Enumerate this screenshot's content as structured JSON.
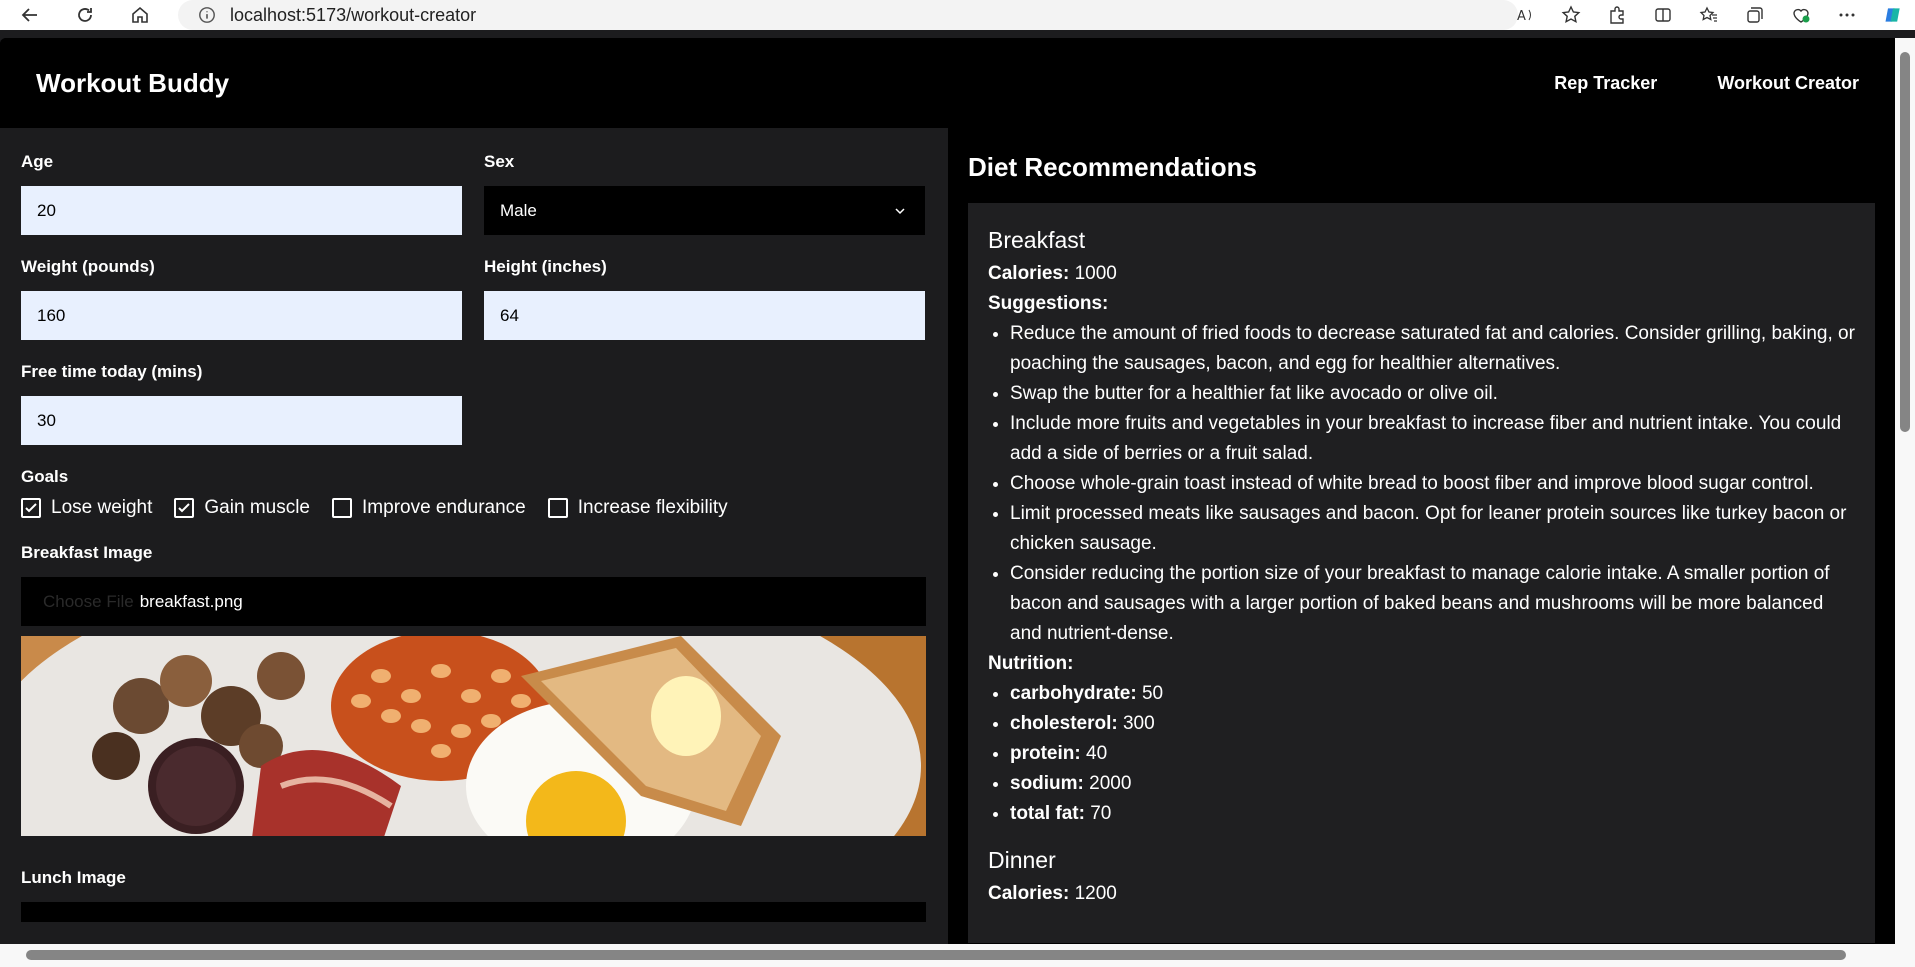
{
  "browser": {
    "url": "localhost:5173/workout-creator"
  },
  "header": {
    "brand": "Workout Buddy",
    "nav": [
      "Rep Tracker",
      "Workout Creator"
    ]
  },
  "form": {
    "age_label": "Age",
    "age_value": "20",
    "sex_label": "Sex",
    "sex_value": "Male",
    "weight_label": "Weight (pounds)",
    "weight_value": "160",
    "height_label": "Height (inches)",
    "height_value": "64",
    "free_time_label": "Free time today (mins)",
    "free_time_value": "30",
    "goals_label": "Goals",
    "goals": [
      {
        "label": "Lose weight",
        "checked": true
      },
      {
        "label": "Gain muscle",
        "checked": true
      },
      {
        "label": "Improve endurance",
        "checked": false
      },
      {
        "label": "Increase flexibility",
        "checked": false
      }
    ],
    "breakfast_image_label": "Breakfast Image",
    "choose_file": "Choose File",
    "breakfast_file": "breakfast.png",
    "lunch_image_label": "Lunch Image"
  },
  "diet": {
    "title": "Diet Recommendations",
    "breakfast": {
      "title": "Breakfast",
      "calories_label": "Calories:",
      "calories": "1000",
      "suggestions_label": "Suggestions:",
      "suggestions": [
        "Reduce the amount of fried foods to decrease saturated fat and calories. Consider grilling, baking, or poaching the sausages, bacon, and egg for healthier alternatives.",
        "Swap the butter for a healthier fat like avocado or olive oil.",
        "Include more fruits and vegetables in your breakfast to increase fiber and nutrient intake. You could add a side of berries or a fruit salad.",
        "Choose whole-grain toast instead of white bread to boost fiber and improve blood sugar control.",
        "Limit processed meats like sausages and bacon. Opt for leaner protein sources like turkey bacon or chicken sausage.",
        "Consider reducing the portion size of your breakfast to manage calorie intake. A smaller portion of bacon and sausages with a larger portion of baked beans and mushrooms will be more balanced and nutrient-dense."
      ],
      "nutrition_label": "Nutrition:",
      "nutrition": [
        {
          "name": "carbohydrate:",
          "value": "50"
        },
        {
          "name": "cholesterol:",
          "value": "300"
        },
        {
          "name": "protein:",
          "value": "40"
        },
        {
          "name": "sodium:",
          "value": "2000"
        },
        {
          "name": "total fat:",
          "value": "70"
        }
      ]
    },
    "dinner": {
      "title": "Dinner",
      "calories_label": "Calories:",
      "calories": "1200"
    }
  }
}
